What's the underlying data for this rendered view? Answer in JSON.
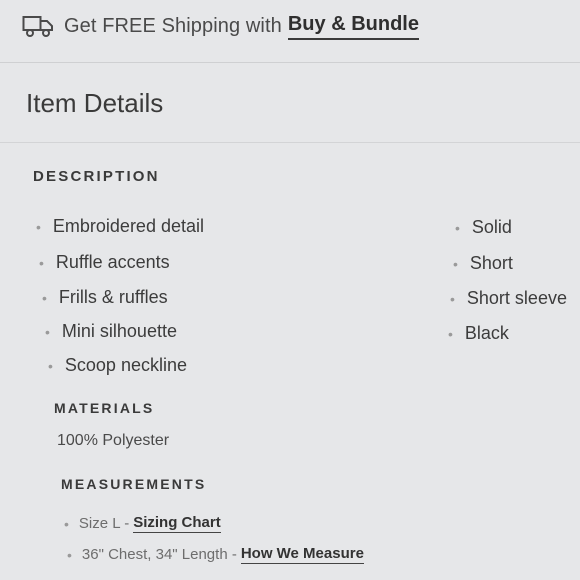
{
  "shipping_banner": {
    "icon": "truck-icon",
    "text": "Get FREE Shipping with",
    "link": "Buy & Bundle"
  },
  "item_details": {
    "title": "Item Details",
    "description": {
      "heading": "DESCRIPTION",
      "left": [
        "Embroidered detail",
        "Ruffle accents",
        "Frills & ruffles",
        "Mini silhouette",
        "Scoop neckline"
      ],
      "right": [
        "Solid",
        "Short",
        "Short sleeve",
        "Black"
      ]
    },
    "materials": {
      "heading": "MATERIALS",
      "value": "100% Polyester"
    },
    "measurements": {
      "heading": "MEASUREMENTS",
      "size_text": "Size L -",
      "size_link": "Sizing Chart",
      "dims_text": "36\" Chest, 34\" Length -",
      "dims_link": "How We Measure"
    }
  }
}
